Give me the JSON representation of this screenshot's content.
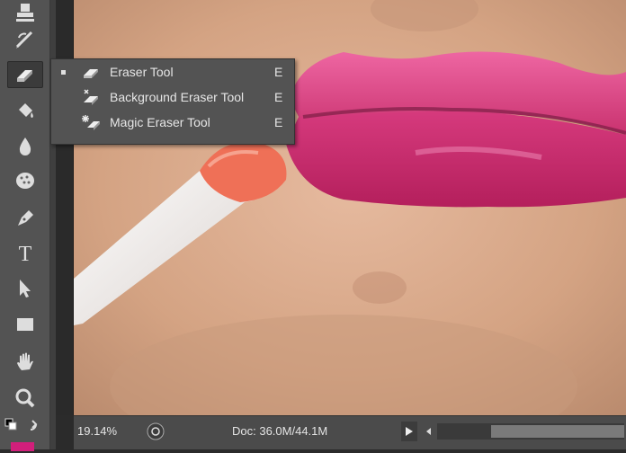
{
  "app": {
    "accent_color": "#d21f7b"
  },
  "toolbar": {
    "tools": [
      {
        "name": "clone-stamp-icon"
      },
      {
        "name": "history-brush-icon"
      },
      {
        "name": "eraser-icon",
        "active": true
      },
      {
        "name": "paint-bucket-icon"
      },
      {
        "name": "blur-icon"
      },
      {
        "name": "sponge-icon"
      },
      {
        "name": "pen-icon"
      },
      {
        "name": "type-icon",
        "glyph": "T"
      },
      {
        "name": "path-selection-icon"
      },
      {
        "name": "rectangle-icon"
      },
      {
        "name": "hand-icon"
      },
      {
        "name": "zoom-icon"
      }
    ],
    "foreground_color": "#d21f7b"
  },
  "flyout": {
    "items": [
      {
        "label": "Eraser Tool",
        "shortcut": "E",
        "selected": true,
        "icon": "eraser-icon"
      },
      {
        "label": "Background Eraser Tool",
        "shortcut": "E",
        "selected": false,
        "icon": "background-eraser-icon"
      },
      {
        "label": "Magic Eraser Tool",
        "shortcut": "E",
        "selected": false,
        "icon": "magic-eraser-icon"
      }
    ]
  },
  "status": {
    "zoom": "19.14%",
    "doc_info": "Doc: 36.0M/44.1M"
  }
}
